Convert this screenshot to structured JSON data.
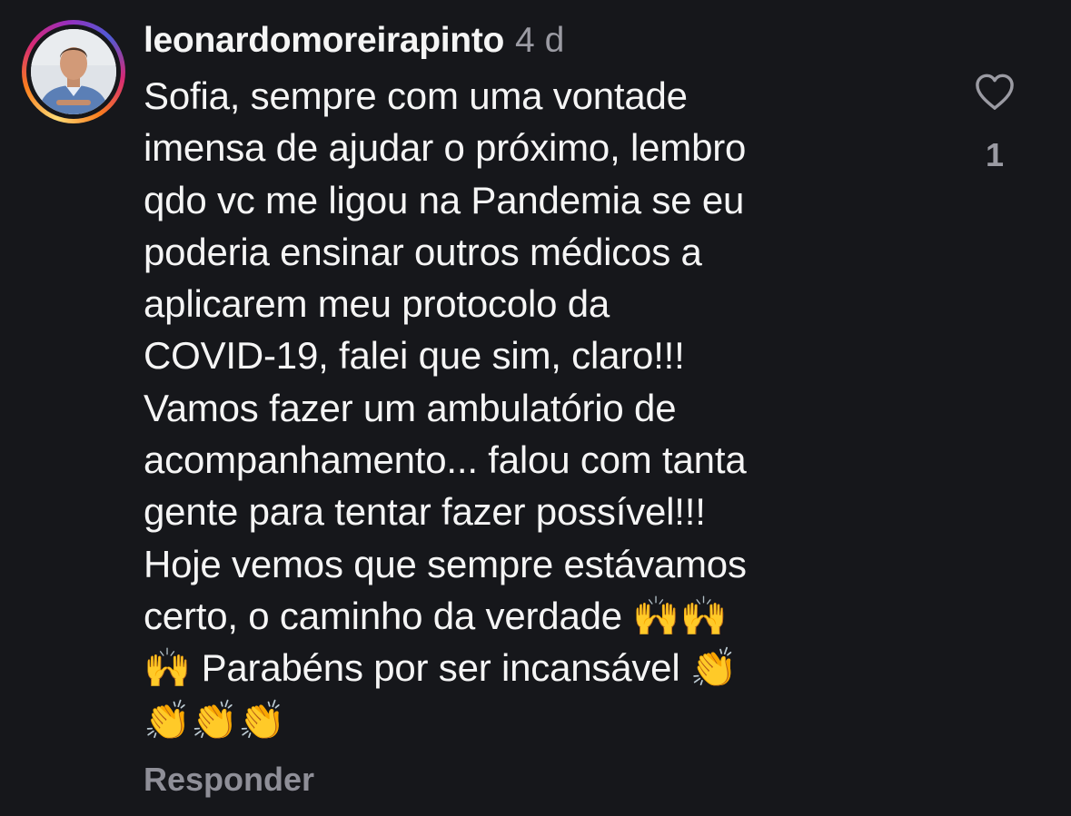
{
  "comment": {
    "username": "leonardomoreirapinto",
    "timestamp": "4 d",
    "text": "Sofia, sempre com uma vontade\nimensa de ajudar o próximo, lembro\nqdo vc me ligou na Pandemia se eu\npoderia ensinar outros médicos a\naplicarem meu protocolo da\nCOVID-19, falei que sim, claro!!!\nVamos fazer um ambulatório de\nacompanhamento... falou com tanta\ngente para tentar fazer possível!!!\nHoje vemos que sempre estávamos\ncerto, o caminho da verdade 🙌🙌\n🙌 Parabéns por ser incansável 👏\n👏👏👏",
    "like_icon": "heart-outline-icon",
    "like_count": "1",
    "reply_label": "Responder"
  },
  "colors": {
    "background": "#16171b",
    "text": "#f5f5f5",
    "secondary_text": "#9b9ba3",
    "story_ring": "#d62976"
  }
}
